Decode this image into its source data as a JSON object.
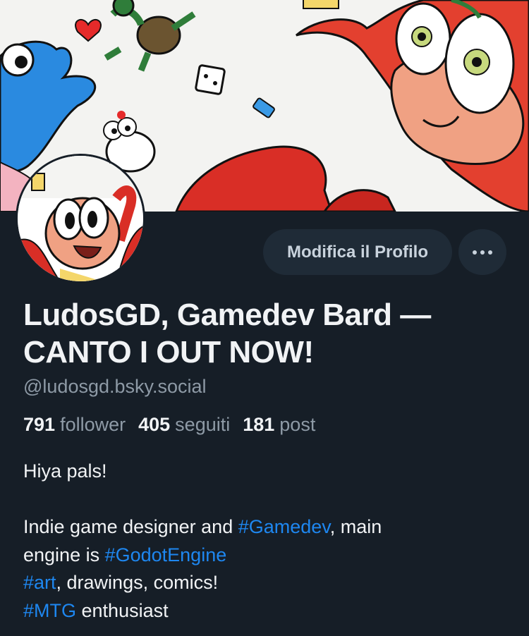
{
  "profile": {
    "display_name_line1": "LudosGD, Gamedev Bard —",
    "display_name_line2": "CANTO I OUT NOW!",
    "handle": "@ludosgd.bsky.social"
  },
  "actions": {
    "edit_profile_label": "Modifica il Profilo",
    "more_label": "•••"
  },
  "stats": {
    "followers_count": "791",
    "followers_label": "follower",
    "following_count": "405",
    "following_label": "seguiti",
    "posts_count": "181",
    "posts_label": "post"
  },
  "bio": {
    "line1": "Hiya pals!",
    "line3_pre": "Indie game designer and ",
    "line3_tag": "#Gamedev",
    "line3_post": ", main",
    "line4_pre": "engine is ",
    "line4_tag": "#GodotEngine",
    "line5_tag": "#art",
    "line5_post": ", drawings, comics!",
    "line6_tag": "#MTG",
    "line6_post": " enthusiast"
  },
  "colors": {
    "background": "#161e27",
    "button_bg": "#1f2b37",
    "hashtag": "#1e87f0",
    "muted_text": "#8e9aa6"
  }
}
